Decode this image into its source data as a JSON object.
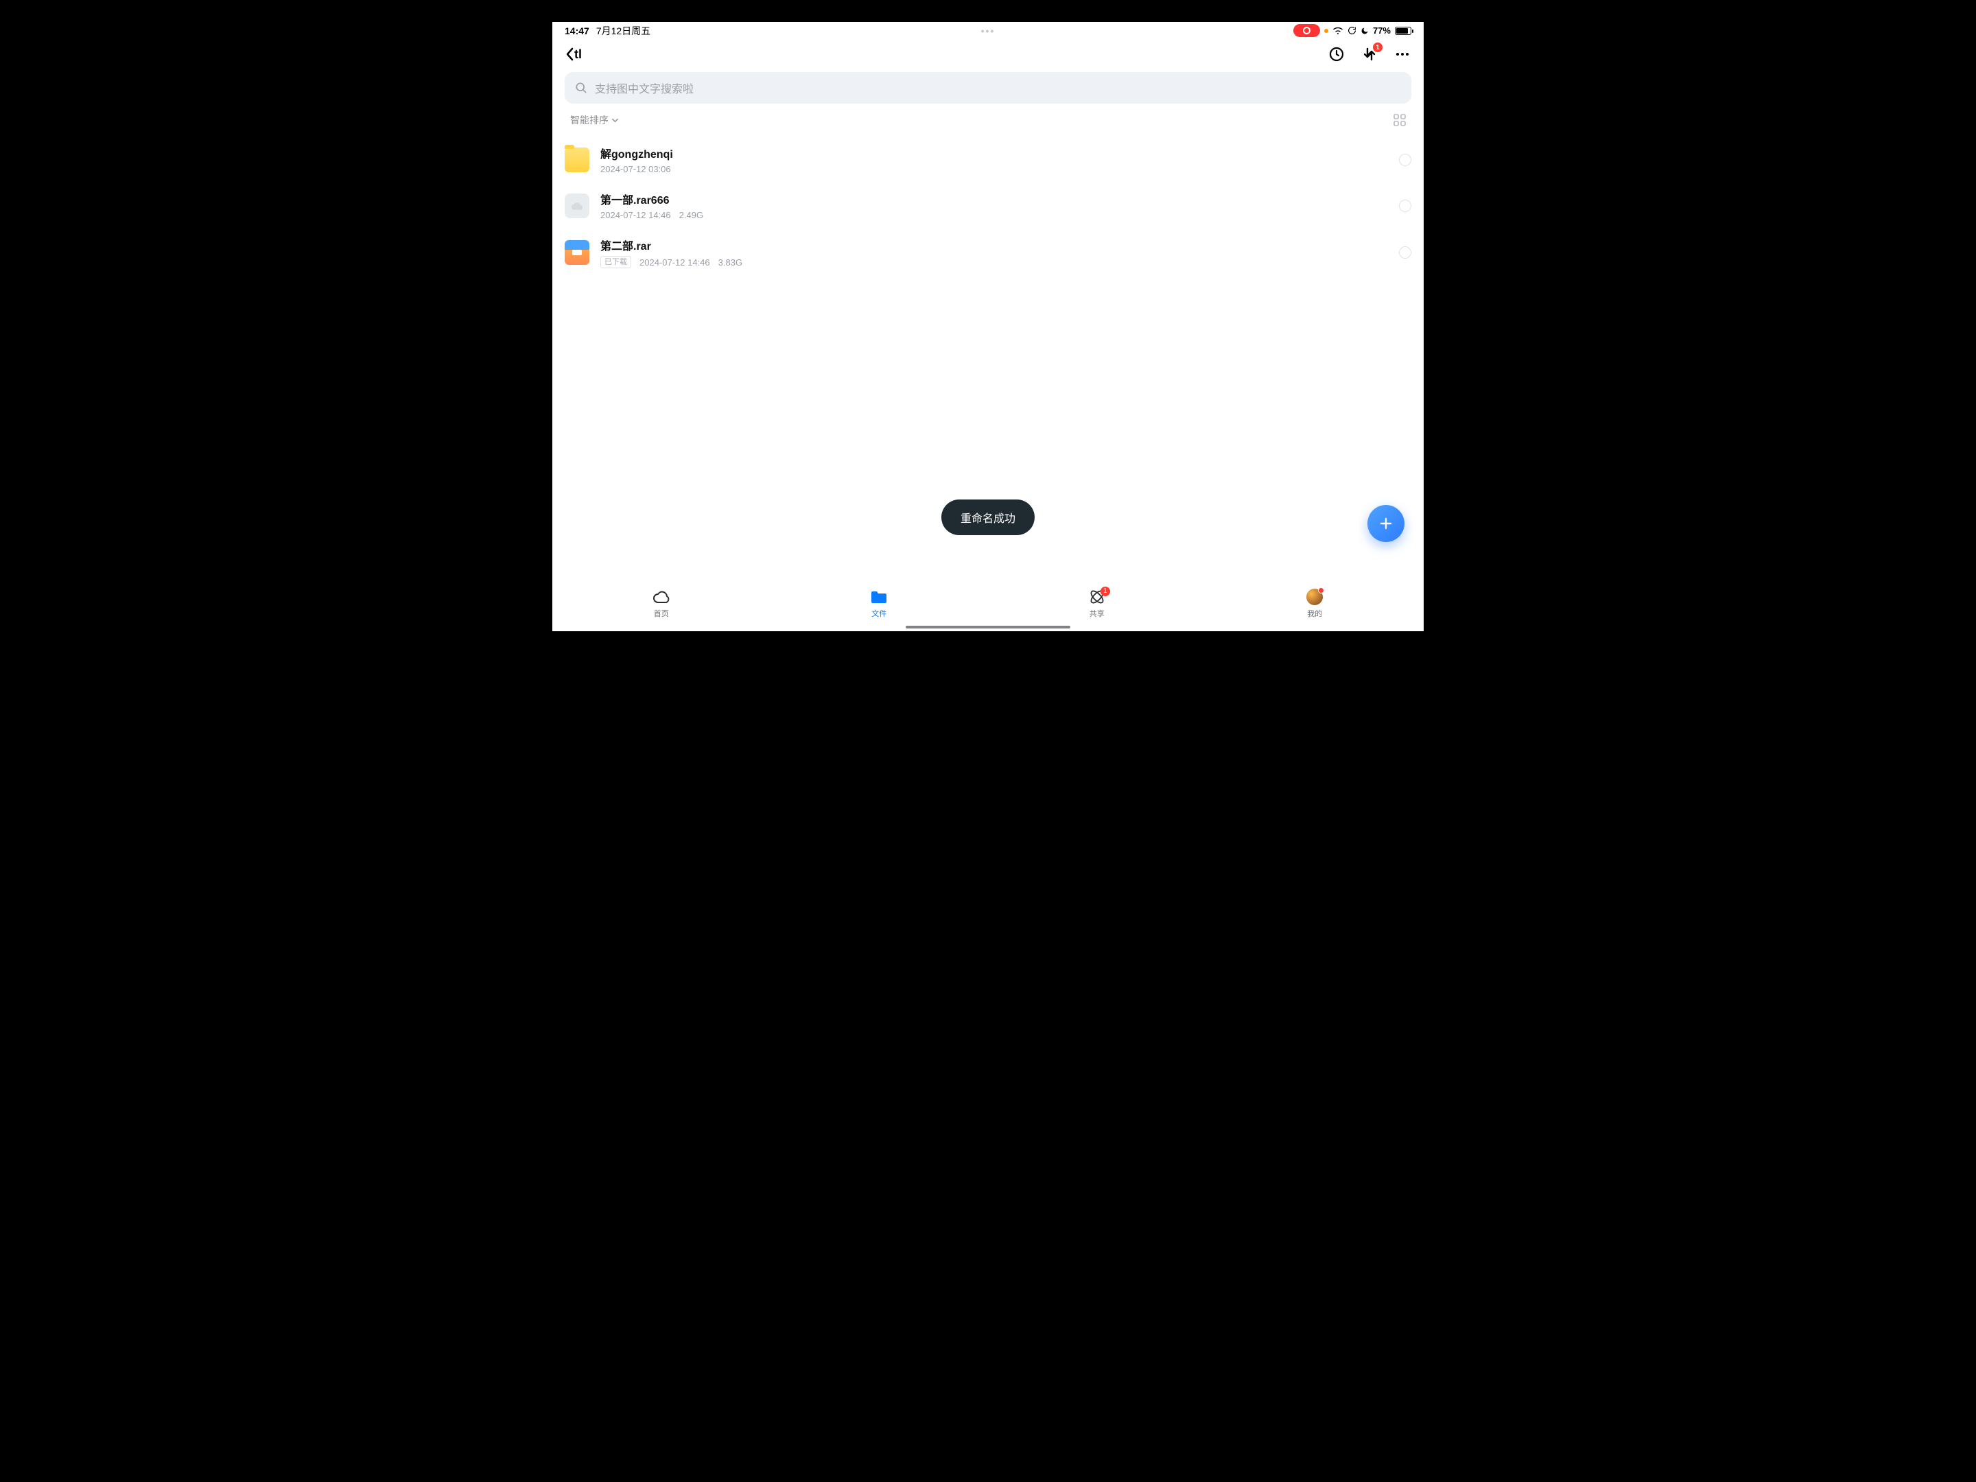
{
  "statusbar": {
    "time": "14:47",
    "date": "7月12日周五",
    "battery_text": "77%"
  },
  "header": {
    "back_label": "tl",
    "transfer_badge": "1"
  },
  "search": {
    "placeholder": "支持图中文字搜索啦"
  },
  "sort": {
    "label": "智能排序"
  },
  "files": [
    {
      "name": "解gongzhenqi",
      "date": "2024-07-12 03:06",
      "size": "",
      "kind": "folder",
      "badge": ""
    },
    {
      "name": "第一部.rar666",
      "date": "2024-07-12 14:46",
      "size": "2.49G",
      "kind": "cloud",
      "badge": ""
    },
    {
      "name": "第二部.rar",
      "date": "2024-07-12 14:46",
      "size": "3.83G",
      "kind": "rar",
      "badge": "已下载"
    }
  ],
  "toast": "重命名成功",
  "tabs": {
    "home": "首页",
    "files": "文件",
    "share": "共享",
    "share_badge": "1",
    "mine": "我的"
  }
}
